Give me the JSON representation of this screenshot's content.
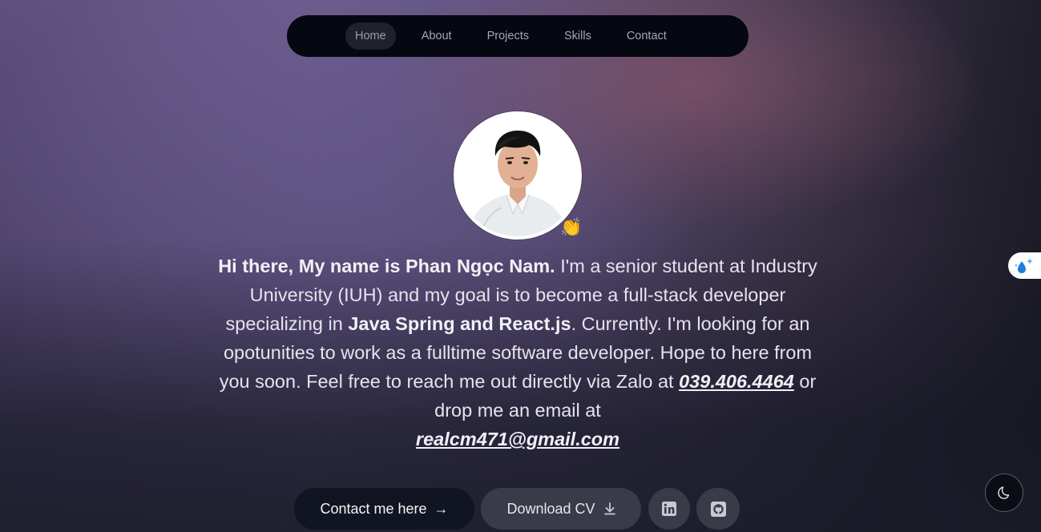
{
  "nav": {
    "items": [
      {
        "label": "Home",
        "active": true
      },
      {
        "label": "About"
      },
      {
        "label": "Projects"
      },
      {
        "label": "Skills"
      },
      {
        "label": "Contact"
      }
    ]
  },
  "profile": {
    "avatar_icon": "profile-photo",
    "wave_emoji": "👏"
  },
  "intro": {
    "greeting": "Hi there, My name is Phan Ngọc Nam.",
    "part1": " I'm a senior student at Industry University (IUH) and my goal is to become a full-stack developer specializing in ",
    "stack": "Java Spring and React.js",
    "part2": ". Currently. I'm looking for an opotunities to work as a fulltime software developer. Hope to here from you soon. Feel free to reach me out directly via Zalo at ",
    "phone": "039.406.4464",
    "part3": " or drop me an email at ",
    "email": "realcm471@gmail.com"
  },
  "actions": {
    "contact_label": "Contact me here",
    "contact_arrow": "→",
    "cv_label": "Download CV",
    "linkedin_icon": "linkedin-icon",
    "github_icon": "github-icon"
  },
  "widgets": {
    "theme_icon": "moon-icon",
    "side_icon": "sparkle-drop-icon"
  },
  "colors": {
    "nav_bg": "#050810",
    "contact_btn_bg": "#111521",
    "cv_btn_bg": "#3a3b48"
  }
}
